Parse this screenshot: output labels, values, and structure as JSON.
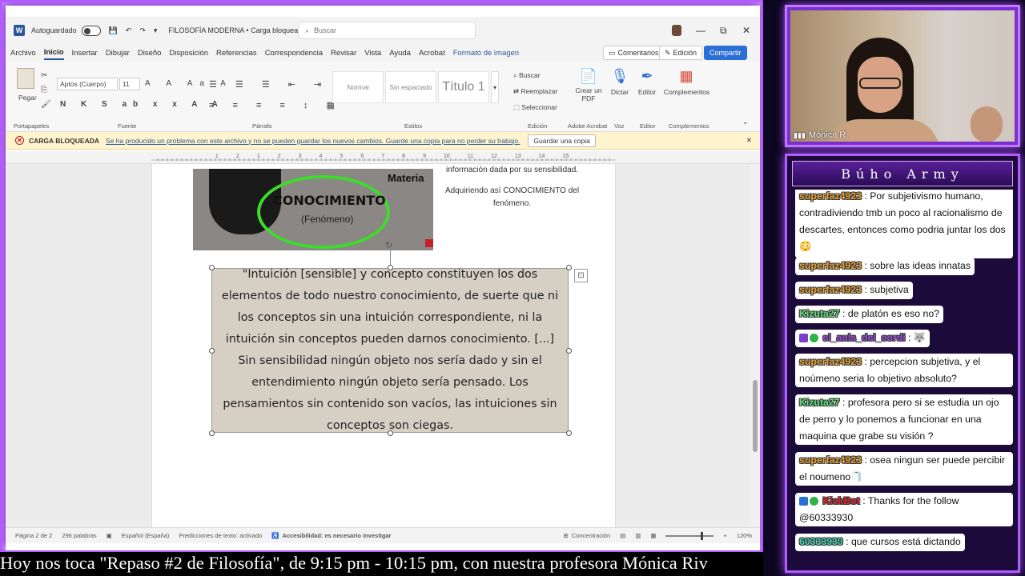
{
  "word": {
    "autosave_label": "Autoguardado",
    "doc_title": "FILOSOFÍA MODERNA • Carga bloqueada",
    "search_placeholder": "Buscar",
    "menu_tabs": [
      "Archivo",
      "Inicio",
      "Insertar",
      "Dibujar",
      "Diseño",
      "Disposición",
      "Referencias",
      "Correspondencia",
      "Revisar",
      "Vista",
      "Ayuda",
      "Acrobat",
      "Formato de imagen"
    ],
    "btn_comments": "Comentarios",
    "btn_edit": "Edición",
    "btn_share": "Compartir",
    "ribbon": {
      "paste": "Pegar",
      "font_name": "Aptos (Cuerpo)",
      "font_size": "11",
      "style_normal": "Normal",
      "style_nospace": "Sin espaciado",
      "style_title": "Título 1",
      "find": "Buscar",
      "replace": "Reemplazar",
      "select": "Seleccionar",
      "create_pdf": "Crear un PDF",
      "dictate": "Dictar",
      "editor": "Editor",
      "addins": "Complementos",
      "groups": [
        "Portapapeles",
        "Fuente",
        "Párrafo",
        "Estilos",
        "Edición",
        "Adobe Acrobat",
        "Voz",
        "Editor",
        "Complementos"
      ]
    },
    "warning": {
      "title": "CARGA BLOQUEADA",
      "message": "Se ha producido un problema con este archivo y no se pueden guardar los nuevos cambios. Guarde una copia para no perder su trabajo.",
      "button": "Guardar una copia"
    },
    "ruler_marks": [
      "1",
      "2",
      "1",
      "2",
      "3",
      "4",
      "5",
      "6",
      "7",
      "8",
      "9",
      "10",
      "11",
      "12",
      "13",
      "14",
      "15"
    ],
    "doc": {
      "img_materia": "Materia",
      "img_conocimiento": "CONOCIMIENTO",
      "img_fenomeno": "(Fenómeno)",
      "side_line1": "información dada por su sensibilidad.",
      "side_line2": "Adquiriendo así CONOCIMIENTO del fenómeno.",
      "quote": "\"Intuición [sensible] y concepto constituyen los dos elementos de todo nuestro conocimiento, de suerte que ni los conceptos sin una intuición correspondiente, ni la intuición sin conceptos pueden darnos conocimiento. [...] Sin sensibilidad ningún objeto nos sería dado y sin el entendimiento ningún objeto sería pensado. Los pensamientos sin contenido son vacíos, las intuiciones sin conceptos son ciegas."
    },
    "status": {
      "page": "Página 2 de 2",
      "words": "296 palabras",
      "language": "Español (España)",
      "predictions": "Predicciones de texto: activado",
      "accessibility": "Accesibilidad: es necesario investigar",
      "focus": "Concentración",
      "zoom": "120%"
    }
  },
  "ticker": "Hoy nos toca \"Repaso #2 de Filosofía\", de 9:15 pm - 10:15 pm, con nuestra profesora Mónica Riv",
  "camera": {
    "name": "Mónica R."
  },
  "chat": {
    "title": "Búho Army",
    "messages": [
      {
        "user": "superfaz4923",
        "text": "Por subjetivismo humano, contradiviendo tmb un poco al racionalismo de descartes, entonces como podria juntar los dos😳"
      },
      {
        "user": "superfaz4923",
        "text": "sobre las ideas innatas"
      },
      {
        "user": "superfaz4923",
        "text": "subjetiva"
      },
      {
        "user": "Kizuta27",
        "text": "de platón es eso no?"
      },
      {
        "user": "el_aula_del_cordi",
        "text": "🐺"
      },
      {
        "user": "superfaz4923",
        "text": "percepcion subjetiva, y el noúmeno seria lo objetivo absoluto?"
      },
      {
        "user": "Kizuta27",
        "text": "profesora pero si se estudia un ojo de perro y lo ponemos a funcionar en una maquina que grabe su visión ?"
      },
      {
        "user": "superfaz4923",
        "text": "osea ningun ser puede percibir el noumeno🧻"
      },
      {
        "user": "KickBot",
        "text": "Thanks for the follow @60333930"
      },
      {
        "user": "60333930",
        "text": "que cursos está dictando"
      }
    ]
  },
  "colors": {
    "frame": "#7a2fcf",
    "word_blue": "#2b579a",
    "warning_bg": "#fff4ce"
  }
}
